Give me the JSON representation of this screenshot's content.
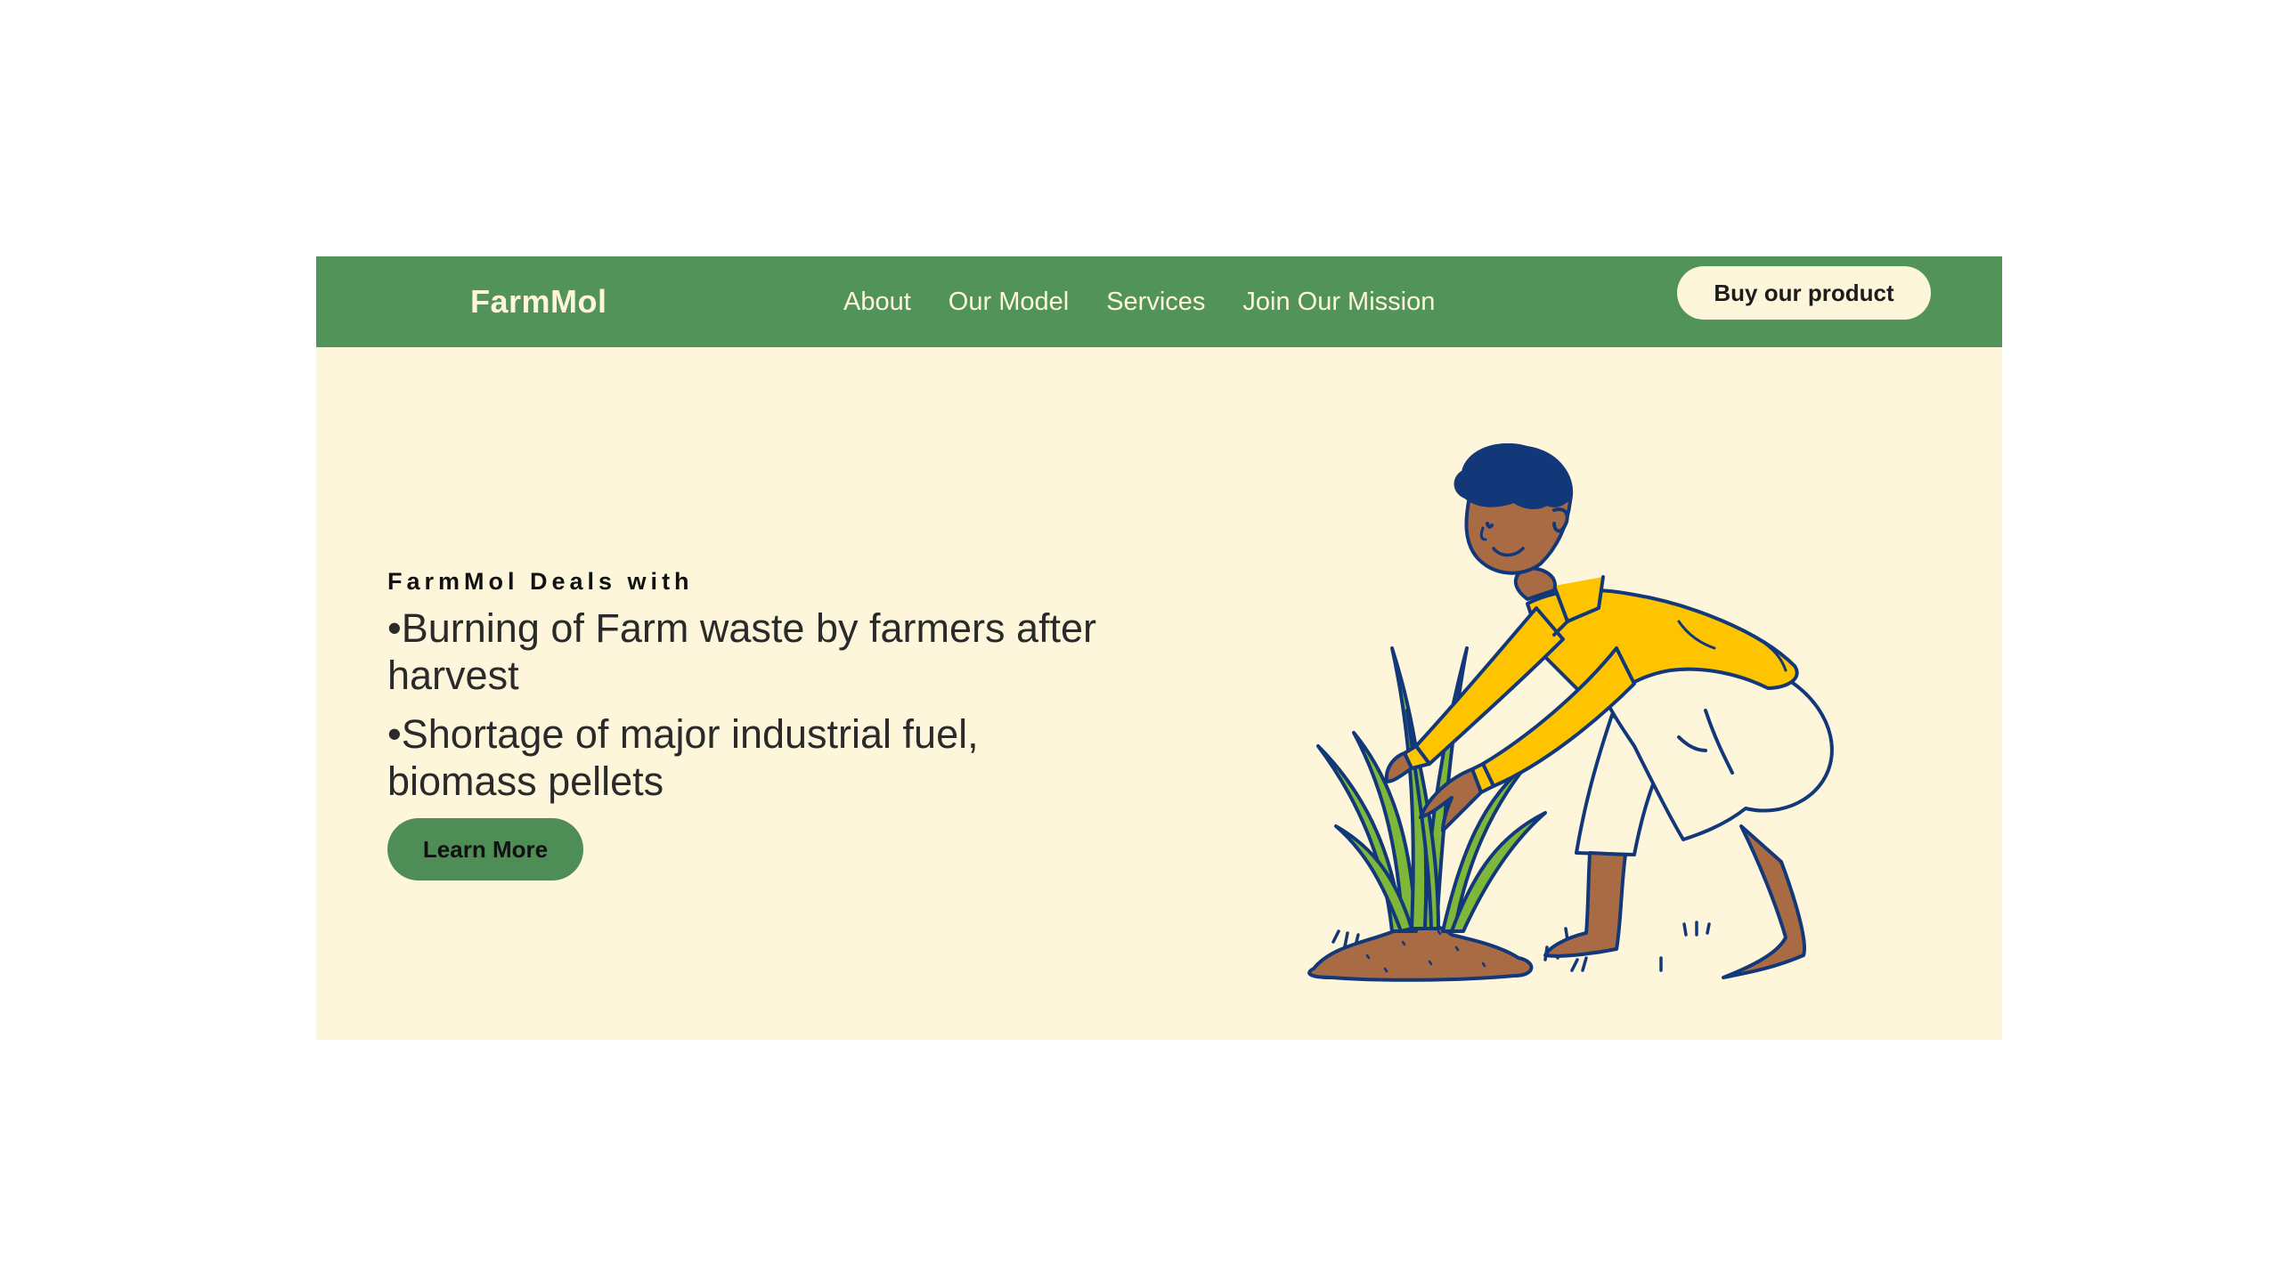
{
  "brand": {
    "name": "FarmMol"
  },
  "nav": {
    "links": [
      {
        "label": "About"
      },
      {
        "label": "Our Model"
      },
      {
        "label": "Services"
      },
      {
        "label": "Join Our Mission"
      }
    ],
    "cta_label": "Buy our product"
  },
  "hero": {
    "eyebrow": "FarmMol Deals with",
    "bullets": [
      "•Burning of Farm waste by farmers after harvest",
      "•Shortage of major industrial fuel, biomass pellets"
    ],
    "button_label": "Learn More",
    "illustration_icon": "farmer-planting-icon"
  },
  "colors": {
    "nav_bg": "#52935a",
    "hero_bg": "#fdf6db",
    "button_green": "#4e8d55",
    "outline_blue": "#12387a",
    "shirt_yellow": "#ffc400",
    "skin_brown": "#a86b43",
    "plant_green": "#7fb73a"
  }
}
